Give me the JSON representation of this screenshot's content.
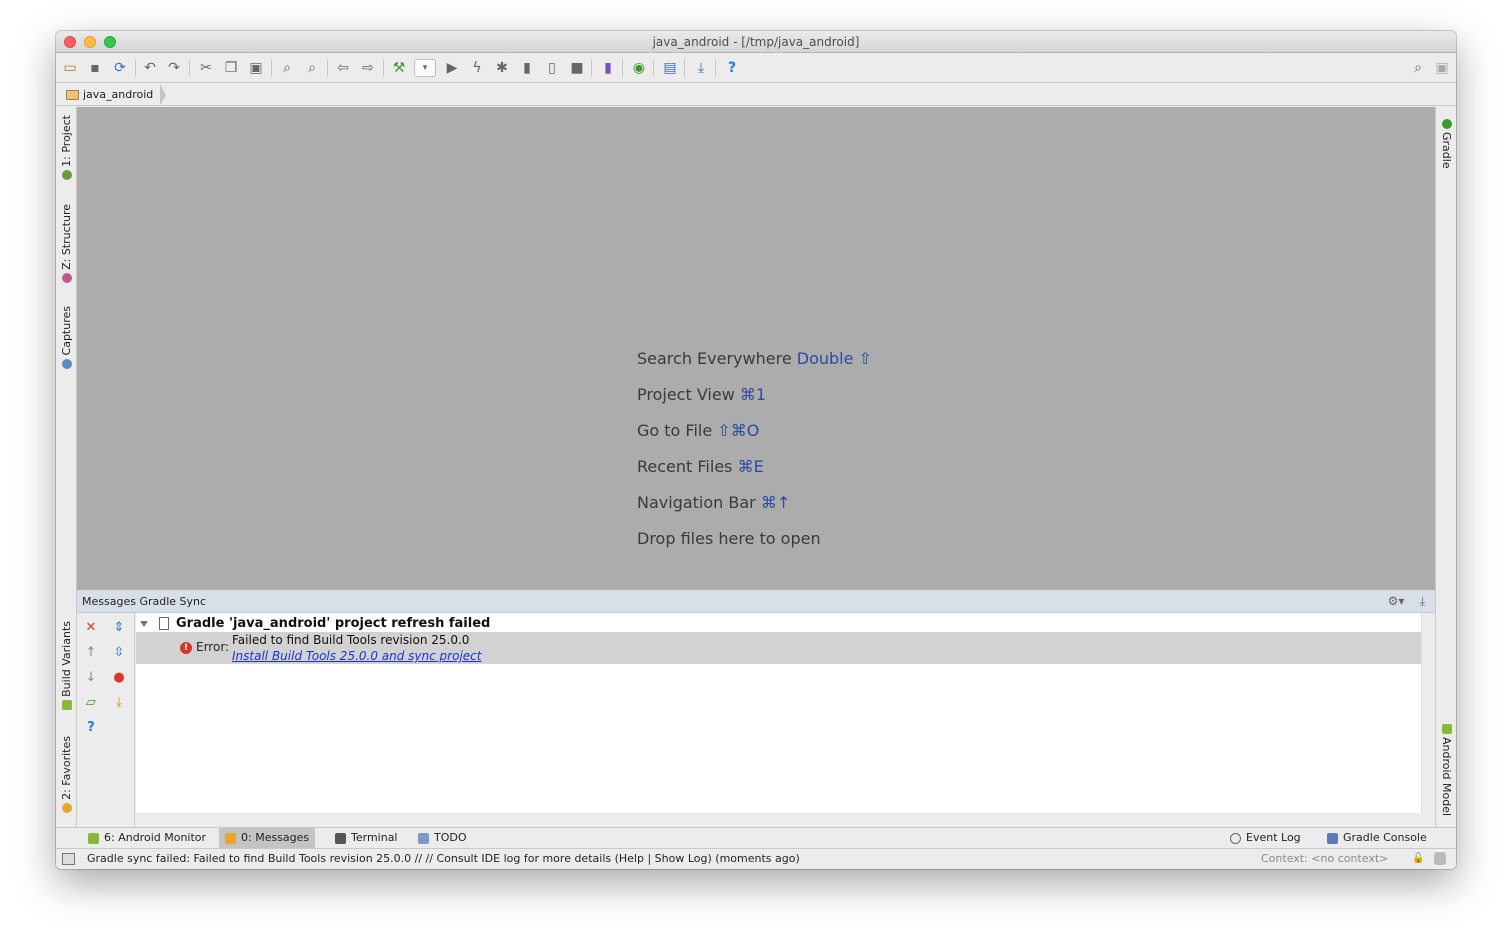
{
  "window": {
    "title": "java_android - [/tmp/java_android]"
  },
  "toolbar": {
    "icons": [
      "open-icon",
      "save-icon",
      "sync-icon",
      "undo-icon",
      "redo-icon",
      "cut-icon",
      "copy-icon",
      "paste-icon",
      "find-icon",
      "replace-icon",
      "back-icon",
      "forward-icon",
      "build-icon",
      "run-config-dropdown",
      "run-icon",
      "apply-changes-icon",
      "debug-icon",
      "profile-icon",
      "attach-icon",
      "stop-icon",
      "avd-icon",
      "gradle-sync-icon",
      "project-structure-icon",
      "sdk-manager-icon",
      "help-icon"
    ],
    "search_icon": "search-icon",
    "user_icon": "user-icon"
  },
  "navbar": {
    "breadcrumb": "java_android"
  },
  "left_tabs": [
    {
      "label": "1: Project"
    },
    {
      "label": "Z: Structure"
    },
    {
      "label": "Captures"
    },
    {
      "label": "Build Variants"
    },
    {
      "label": "2: Favorites"
    }
  ],
  "right_tabs": [
    {
      "label": "Gradle"
    },
    {
      "label": "Android Model"
    }
  ],
  "editor": {
    "hints": [
      {
        "text": "Search Everywhere",
        "key": "Double ⇧"
      },
      {
        "text": "Project View",
        "key": "⌘1"
      },
      {
        "text": "Go to File",
        "key": "⇧⌘O"
      },
      {
        "text": "Recent Files",
        "key": "⌘E"
      },
      {
        "text": "Navigation Bar",
        "key": "⌘↑"
      },
      {
        "text": "Drop files here to open",
        "key": ""
      }
    ]
  },
  "messages": {
    "header": "Messages Gradle Sync",
    "row_title": "Gradle 'java_android' project refresh failed",
    "error_label": "Error:",
    "error_text": "Failed to find Build Tools revision 25.0.0",
    "error_link": "Install Build Tools 25.0.0 and sync project"
  },
  "bottom_tabs": [
    {
      "label": "6: Android Monitor"
    },
    {
      "label": "0: Messages"
    },
    {
      "label": "Terminal"
    },
    {
      "label": "TODO"
    },
    {
      "label": "Event Log"
    },
    {
      "label": "Gradle Console"
    }
  ],
  "status": {
    "text": "Gradle sync failed: Failed to find Build Tools revision 25.0.0 // // Consult IDE log for more details (Help | Show Log) (moments ago)",
    "context": "Context: <no context>"
  },
  "colors": {
    "editor_bg": "#acacac",
    "link": "#1a33d6",
    "hint_key": "#2c4a9e",
    "error": "#d9342b"
  }
}
